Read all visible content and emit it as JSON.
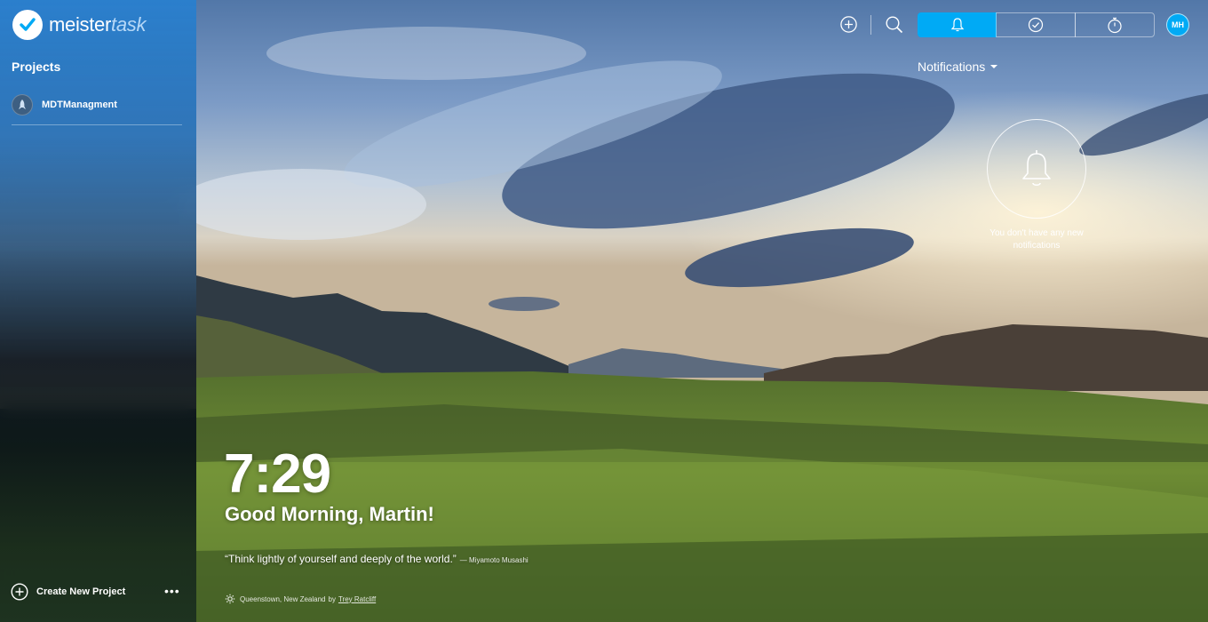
{
  "app": {
    "logo_main": "meister",
    "logo_accent": "task"
  },
  "sidebar": {
    "heading": "Projects",
    "projects": [
      {
        "name": "MDTManagment"
      }
    ],
    "create_label": "Create New Project",
    "more_label": "•••"
  },
  "toolbar": {
    "avatar_initials": "MH",
    "active_tab": "notifications",
    "icons": [
      "add-icon",
      "search-icon",
      "bell-icon",
      "check-circle-icon",
      "stopwatch-icon"
    ]
  },
  "notifications": {
    "title": "Notifications",
    "empty_message": "You don't have any new notifications"
  },
  "greeting": {
    "time": "7:29",
    "message": "Good Morning, Martin!",
    "quote": "“Think lightly of yourself and deeply of the world.”",
    "quote_author": "— Miyamoto Musashi"
  },
  "photo_credit": {
    "location": "Queenstown, New Zealand",
    "by": "by",
    "photographer": "Trey Ratcliff"
  },
  "colors": {
    "accent": "#00aaf5"
  }
}
